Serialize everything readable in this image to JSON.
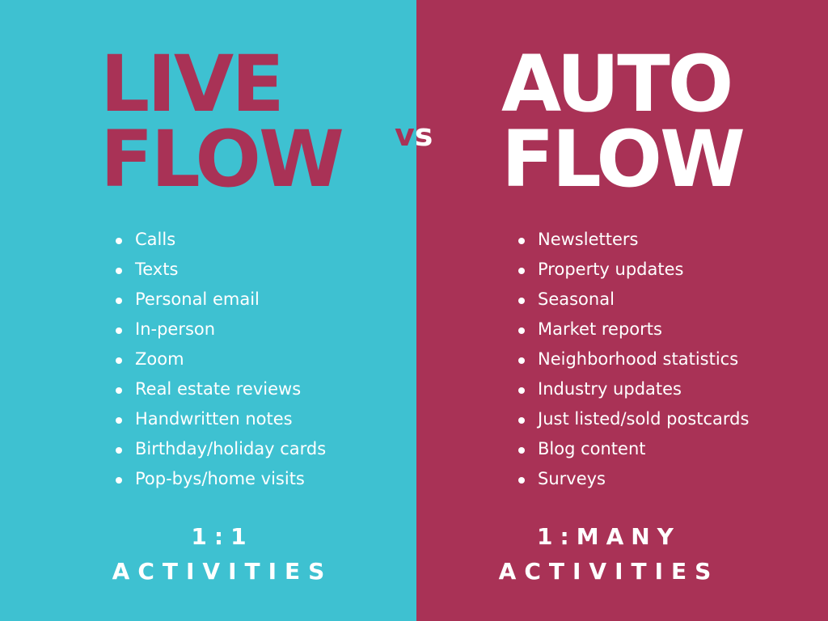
{
  "colors": {
    "left_background": "#3ec1d1",
    "right_background": "#a93256",
    "accent": "#a93256",
    "text_light": "#ffffff"
  },
  "left": {
    "title_line1": "LIVE",
    "title_line2": "FLOW",
    "items": [
      "Calls",
      "Texts",
      "Personal email",
      "In-person",
      "Zoom",
      "Real estate reviews",
      "Handwritten notes",
      "Birthday/holiday cards",
      "Pop-bys/home visits"
    ],
    "footer_ratio": "1:1",
    "footer_label": "ACTIVITIES"
  },
  "vs": {
    "v": "v",
    "s": "s"
  },
  "right": {
    "title_line1": "AUTO",
    "title_line2": "FLOW",
    "items": [
      "Newsletters",
      "Property updates",
      "Seasonal",
      "Market reports",
      "Neighborhood statistics",
      "Industry updates",
      "Just listed/sold postcards",
      "Blog content",
      "Surveys"
    ],
    "footer_ratio": "1:MANY",
    "footer_label": "ACTIVITIES"
  }
}
